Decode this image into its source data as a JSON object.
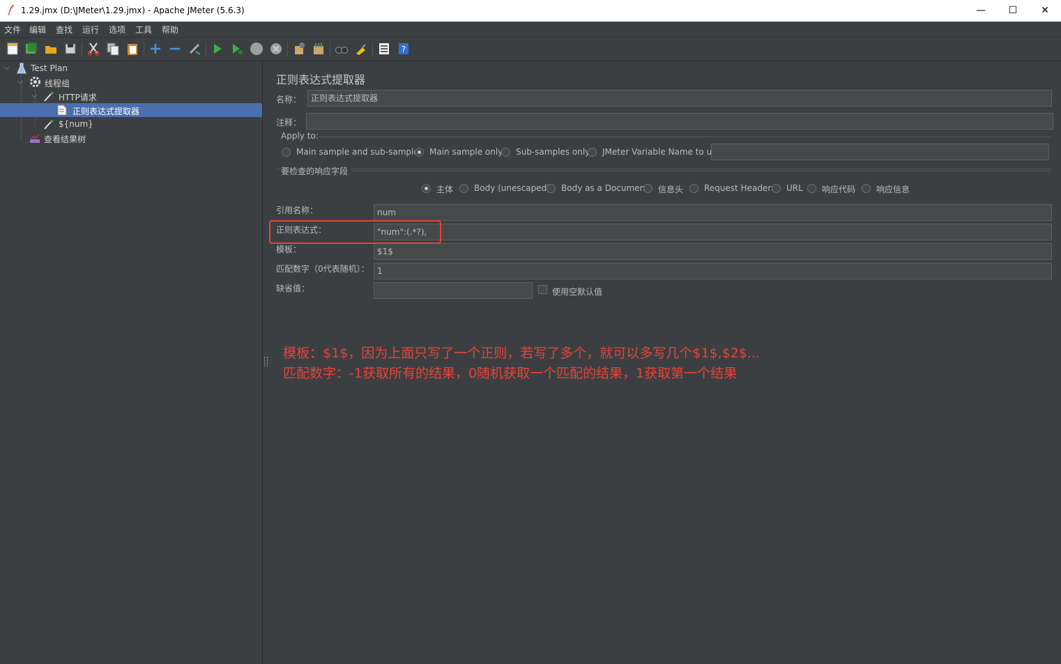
{
  "window": {
    "title": "1.29.jmx (D:\\JMeter\\1.29.jmx) - Apache JMeter (5.6.3)",
    "minimize": "—",
    "maximize": "☐",
    "close": "✕"
  },
  "menu": [
    "文件",
    "编辑",
    "查找",
    "运行",
    "选项",
    "工具",
    "帮助"
  ],
  "toolbar_icons": [
    "new-icon",
    "templates-icon",
    "open-icon",
    "save-icon",
    "cut-icon",
    "copy-icon",
    "paste-icon",
    "expand-icon",
    "collapse-icon",
    "toggle-icon",
    "start-icon",
    "start-no-pause-icon",
    "stop-icon",
    "shutdown-icon",
    "clear-icon",
    "clear-all-icon",
    "search-icon",
    "reset-search-icon",
    "function-helper-icon",
    "help-icon"
  ],
  "tree": [
    {
      "label": "Test Plan",
      "icon": "test-plan-icon"
    },
    {
      "label": "线程组",
      "icon": "gear-icon"
    },
    {
      "label": "HTTP请求",
      "icon": "pipette-icon"
    },
    {
      "label": "正则表达式提取器",
      "icon": "document-icon"
    },
    {
      "label": "${num}",
      "icon": "pipette-icon"
    },
    {
      "label": "查看结果树",
      "icon": "chart-icon"
    }
  ],
  "panel": {
    "title": "正则表达式提取器",
    "name_label": "名称：",
    "name_value": "正则表达式提取器",
    "comment_label": "注释：",
    "comment_value": "",
    "apply_to": "Apply to:",
    "apply_options": [
      "Main sample and sub-samples",
      "Main sample only",
      "Sub-samples only",
      "JMeter Variable Name to use"
    ],
    "apply_selected": "Main sample only",
    "field_section": "要检查的响应字段",
    "field_options": [
      "主体",
      "Body (unescaped)",
      "Body as a Document",
      "信息头",
      "Request Headers",
      "URL",
      "响应代码",
      "响应信息"
    ],
    "field_selected": "主体",
    "ref_label": "引用名称：",
    "ref_value": "num",
    "regex_label": "正则表达式：",
    "regex_value": "\"num\":(.*?),",
    "template_label": "模板：",
    "template_value": "$1$",
    "match_label": "匹配数字（0代表随机）：",
    "match_value": "1",
    "default_label": "缺省值：",
    "default_value": "",
    "use_empty_label": "使用空默认值"
  },
  "annotation": {
    "line1": "模板：$1$，因为上面只写了一个正则，若写了多个，就可以多写几个$1$,$2$...",
    "line2": "匹配数字：-1获取所有的结果，0随机获取一个匹配的结果，1获取第一个结果",
    "color": "#e8433a"
  }
}
